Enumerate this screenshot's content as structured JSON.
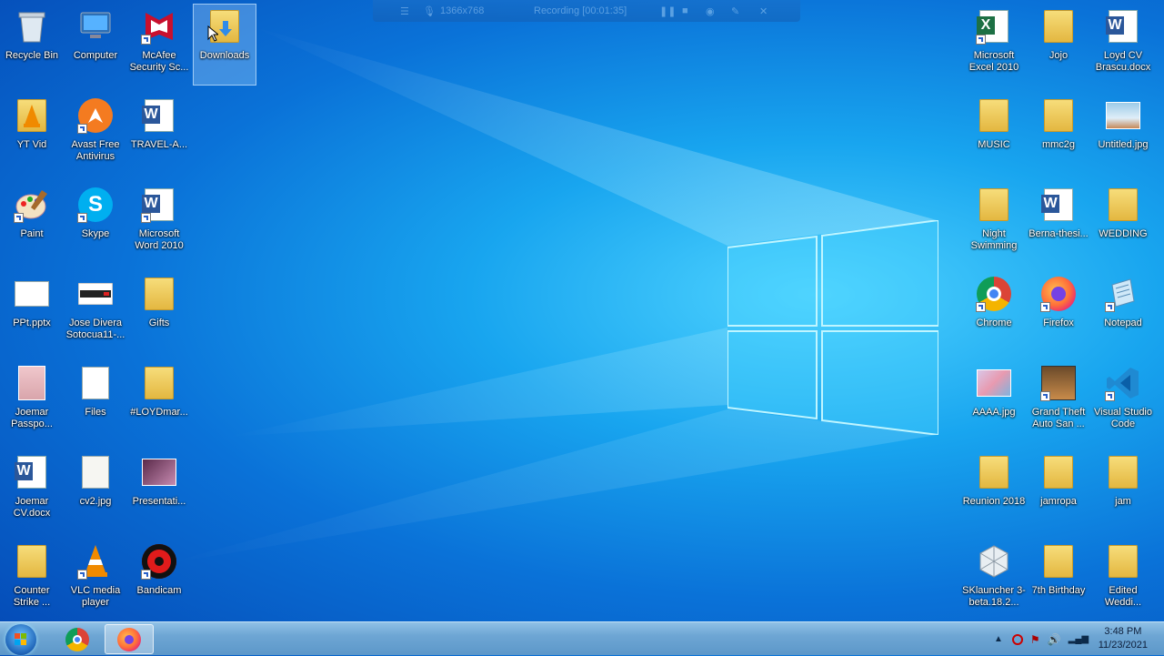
{
  "recording_bar": {
    "resolution": "1366x768",
    "status": "Recording [00:01:35]"
  },
  "desktop": {
    "left_icons": [
      {
        "label": "Recycle Bin",
        "icon": "recycle-bin-icon"
      },
      {
        "label": "Computer",
        "icon": "computer-icon"
      },
      {
        "label": "McAfee Security Sc...",
        "icon": "mcafee-icon"
      },
      {
        "label": "Downloads",
        "icon": "downloads-folder-icon",
        "selected": true
      },
      {
        "label": "YT Vid",
        "icon": "vlc-folder-icon"
      },
      {
        "label": "Avast Free Antivirus",
        "icon": "avast-icon"
      },
      {
        "label": "TRAVEL-A...",
        "icon": "word-doc-icon"
      },
      {
        "label": "Paint",
        "icon": "paint-icon"
      },
      {
        "label": "Skype",
        "icon": "skype-icon"
      },
      {
        "label": "Microsoft Word 2010",
        "icon": "word-icon"
      },
      {
        "label": "PPt.pptx",
        "icon": "pptx-icon"
      },
      {
        "label": "Jose Divera Sotocua11-...",
        "icon": "image-icon"
      },
      {
        "label": "Gifts",
        "icon": "folder-icon"
      },
      {
        "label": "Joemar Passpo...",
        "icon": "image-icon"
      },
      {
        "label": "Files",
        "icon": "files-icon"
      },
      {
        "label": "#LOYDmar...",
        "icon": "folder-icon"
      },
      {
        "label": "Joemar CV.docx",
        "icon": "word-doc-icon"
      },
      {
        "label": "cv2.jpg",
        "icon": "image-icon"
      },
      {
        "label": "Presentati...",
        "icon": "image-icon"
      },
      {
        "label": "Counter Strike ...",
        "icon": "folder-icon"
      },
      {
        "label": "VLC media player",
        "icon": "vlc-icon"
      },
      {
        "label": "Bandicam",
        "icon": "bandicam-icon"
      }
    ],
    "right_icons": [
      {
        "label": "Microsoft Excel 2010",
        "icon": "excel-icon"
      },
      {
        "label": "Jojo",
        "icon": "folder-icon"
      },
      {
        "label": "Loyd CV Brascu.docx",
        "icon": "word-doc-icon"
      },
      {
        "label": "MUSIC",
        "icon": "folder-icon"
      },
      {
        "label": "mmc2g",
        "icon": "folder-icon"
      },
      {
        "label": "Untitled.jpg",
        "icon": "image-icon"
      },
      {
        "label": "Night Swimming",
        "icon": "folder-icon"
      },
      {
        "label": "Berna-thesi...",
        "icon": "word-doc-icon"
      },
      {
        "label": "WEDDING",
        "icon": "folder-icon"
      },
      {
        "label": "Chrome",
        "icon": "chrome-icon"
      },
      {
        "label": "Firefox",
        "icon": "firefox-icon"
      },
      {
        "label": "Notepad",
        "icon": "notepad-icon"
      },
      {
        "label": "AAAA.jpg",
        "icon": "image-icon"
      },
      {
        "label": "Grand Theft Auto San ...",
        "icon": "gta-icon"
      },
      {
        "label": "Visual Studio Code",
        "icon": "vscode-icon"
      },
      {
        "label": "Reunion 2018",
        "icon": "folder-icon"
      },
      {
        "label": "jamropa",
        "icon": "folder-icon"
      },
      {
        "label": "jam",
        "icon": "folder-icon"
      },
      {
        "label": "SKlauncher 3-beta.18.2...",
        "icon": "sklauncher-icon"
      },
      {
        "label": "7th Birthday",
        "icon": "folder-icon"
      },
      {
        "label": "Edited Weddi...",
        "icon": "folder-icon"
      }
    ]
  },
  "taskbar": {
    "apps": [
      {
        "name": "chrome",
        "icon": "chrome-icon"
      },
      {
        "name": "firefox",
        "icon": "firefox-icon",
        "active": true
      }
    ],
    "clock_time": "3:48 PM",
    "clock_date": "11/23/2021"
  },
  "colors": {
    "accent": "#1a8fe8",
    "taskbar": "#6ea6d4"
  }
}
